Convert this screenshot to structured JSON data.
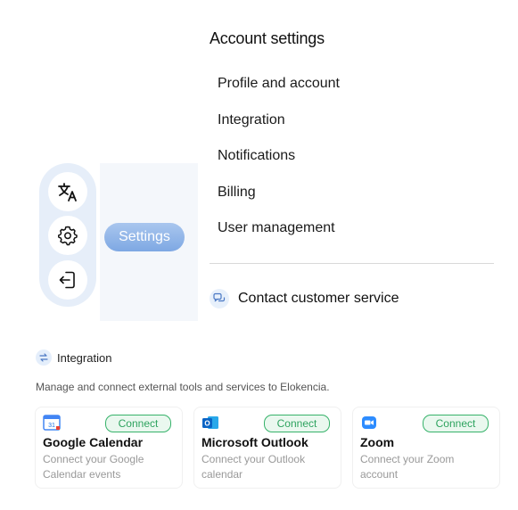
{
  "account_settings": {
    "title": "Account settings",
    "items": [
      "Profile and account",
      "Integration",
      "Notifications",
      "Billing",
      "User management"
    ],
    "contact_label": "Contact customer service"
  },
  "sidebar": {
    "icons": [
      "translate-icon",
      "gear-icon",
      "logout-icon"
    ],
    "tooltip": "Settings"
  },
  "integration": {
    "heading": "Integration",
    "description": "Manage and connect external tools and services to Elokencia.",
    "cards": [
      {
        "name": "Google Calendar",
        "description": "Connect your Google Calendar events",
        "button": "Connect",
        "logo_text": "31"
      },
      {
        "name": "Microsoft Outlook",
        "description": "Connect your Outlook calendar",
        "button": "Connect",
        "logo_text": "O"
      },
      {
        "name": "Zoom",
        "description": "Connect your Zoom account",
        "button": "Connect"
      }
    ]
  },
  "colors": {
    "accent_blue": "#7ea8e3",
    "connect_green": "#2ea35f",
    "pill_bg": "#e6eef9"
  }
}
